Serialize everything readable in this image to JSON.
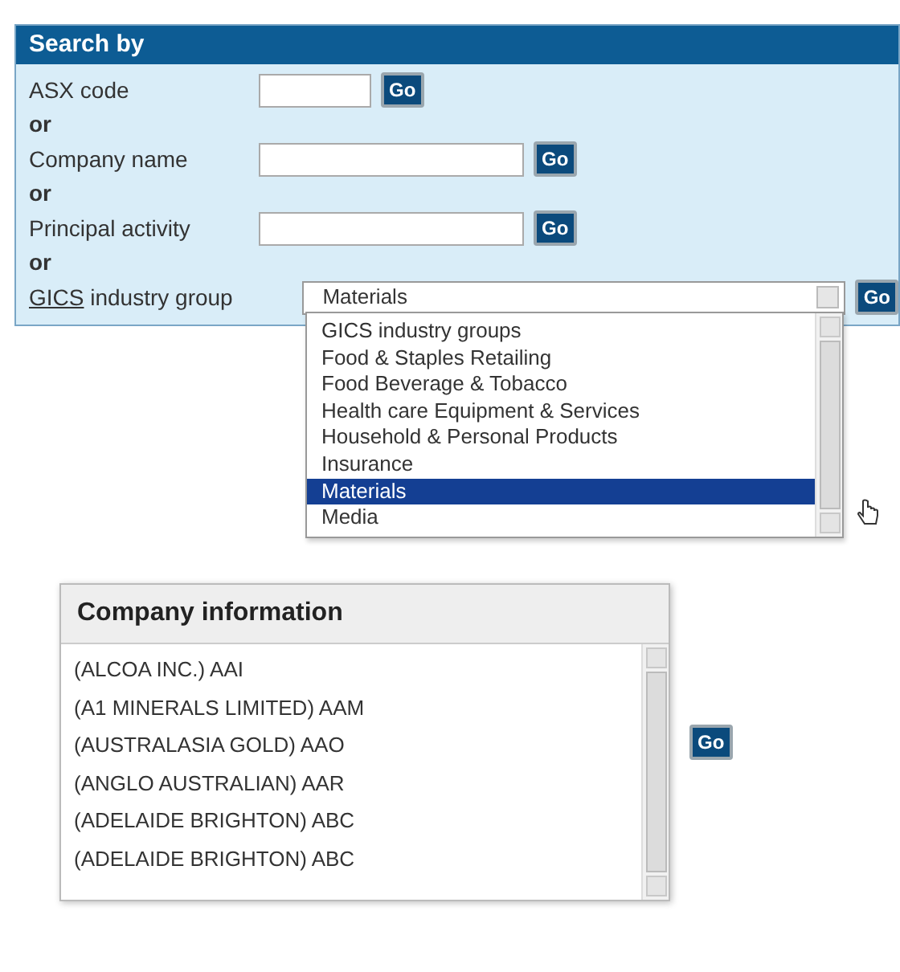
{
  "search_panel": {
    "title": "Search by",
    "rows": [
      {
        "kind": "short_text",
        "label": "ASX code",
        "button": "Go"
      },
      {
        "kind": "or",
        "label": "or"
      },
      {
        "kind": "text",
        "label": "Company name",
        "button": "Go"
      },
      {
        "kind": "or",
        "label": "or"
      },
      {
        "kind": "text",
        "label": "Principal activity",
        "button": "Go"
      },
      {
        "kind": "or",
        "label": "or"
      },
      {
        "kind": "select",
        "link": "GICS",
        "label": "industry group",
        "value": "Materials",
        "button": "Go",
        "expanded": true,
        "options": [
          {
            "label": "GICS industry groups",
            "selected": false
          },
          {
            "label": "Food & Staples Retailing",
            "selected": false
          },
          {
            "label": "Food Beverage & Tobacco",
            "selected": false
          },
          {
            "label": "Health care Equipment & Services",
            "selected": false
          },
          {
            "label": "Household & Personal Products",
            "selected": false
          },
          {
            "label": "Insurance",
            "selected": false
          },
          {
            "label": "Materials",
            "selected": true
          },
          {
            "label": "Media",
            "selected": false
          }
        ]
      }
    ]
  },
  "company_info": {
    "title": "Company information",
    "items": [
      "(ALCOA INC.) AAI",
      "(A1 MINERALS LIMITED) AAM",
      "(AUSTRALASIA GOLD) AAO",
      "(ANGLO AUSTRALIAN) AAR",
      "(ADELAIDE BRIGHTON) ABC",
      "(ADELAIDE BRIGHTON) ABC"
    ],
    "button": "Go"
  }
}
